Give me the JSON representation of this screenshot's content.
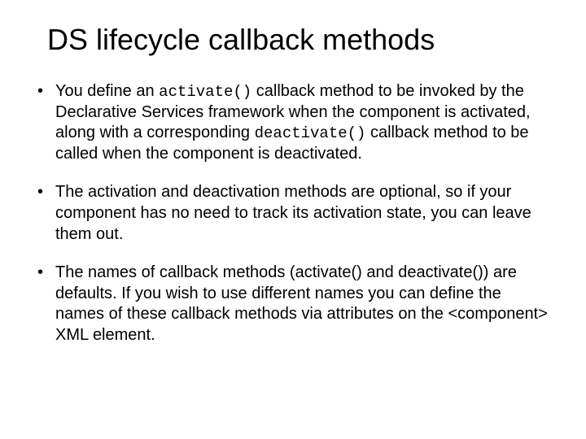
{
  "title": "DS lifecycle callback methods",
  "bullets": {
    "b1": {
      "t1": "You define an ",
      "code1": "activate()",
      "t2": " callback method to be invoked by the Declarative Services framework when the component is activated, along with a corresponding ",
      "code2": "deactivate()",
      "t3": " callback method to be called when the component is deactivated."
    },
    "b2": "The activation and deactivation methods are optional, so if your component has no need to track its activation state, you can leave them out.",
    "b3": "The names of callback methods (activate() and deactivate()) are defaults. If you wish to use different names you can define the names of these callback methods via attributes on the <component> XML element."
  }
}
